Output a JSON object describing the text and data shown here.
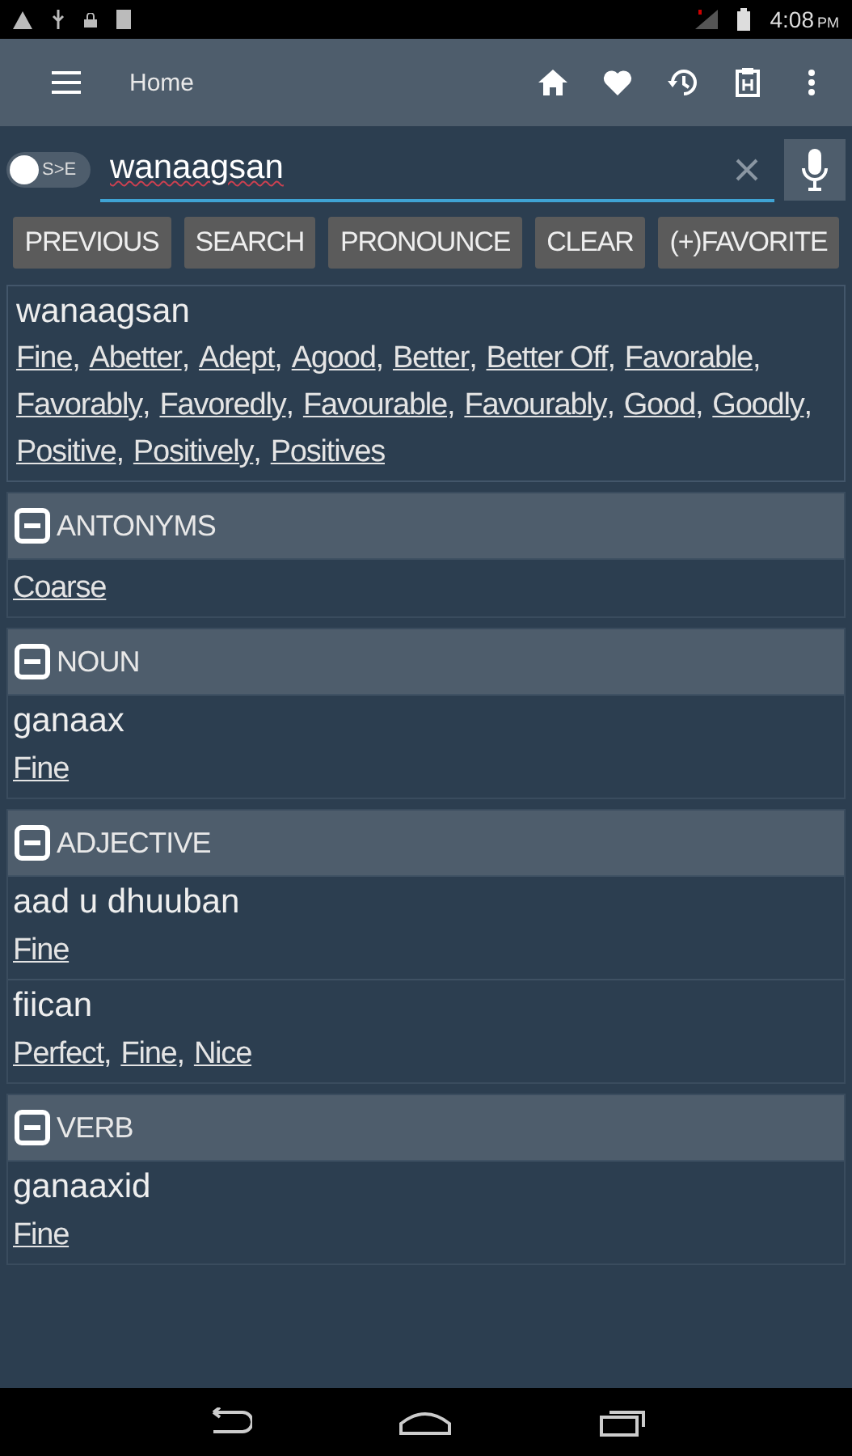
{
  "status_bar": {
    "time": "4:08",
    "period": "PM"
  },
  "app_bar": {
    "title": "Home"
  },
  "search": {
    "toggle": {
      "label": "S>E",
      "on": false
    },
    "value": "wanaagsan"
  },
  "separator": ",",
  "buttons": [
    "PREVIOUS",
    "SEARCH",
    "PRONOUNCE",
    "CLEAR",
    "(+)FAVORITE"
  ],
  "result": {
    "headword": "wanaagsan",
    "synonyms": [
      "Fine",
      "Abetter",
      "Adept",
      "Agood",
      "Better",
      "Better Off",
      "Favorable",
      "Favorably",
      "Favoredly",
      "Favourable",
      "Favourably",
      "Good",
      "Goodly",
      "Positive",
      "Positively",
      "Positives"
    ]
  },
  "sections": [
    {
      "title": "ANTONYMS",
      "expanded": true,
      "entries": [
        {
          "translations": [
            "Coarse"
          ]
        }
      ]
    },
    {
      "title": "NOUN",
      "expanded": true,
      "entries": [
        {
          "word": "ganaax",
          "translations": [
            "Fine"
          ]
        }
      ]
    },
    {
      "title": "ADJECTIVE",
      "expanded": true,
      "entries": [
        {
          "word": "aad u dhuuban",
          "translations": [
            "Fine"
          ]
        },
        {
          "word": "fiican",
          "translations": [
            "Perfect",
            "Fine",
            "Nice"
          ]
        }
      ]
    },
    {
      "title": "VERB",
      "expanded": true,
      "entries": [
        {
          "word": "ganaaxid",
          "translations": [
            "Fine"
          ]
        }
      ]
    }
  ]
}
